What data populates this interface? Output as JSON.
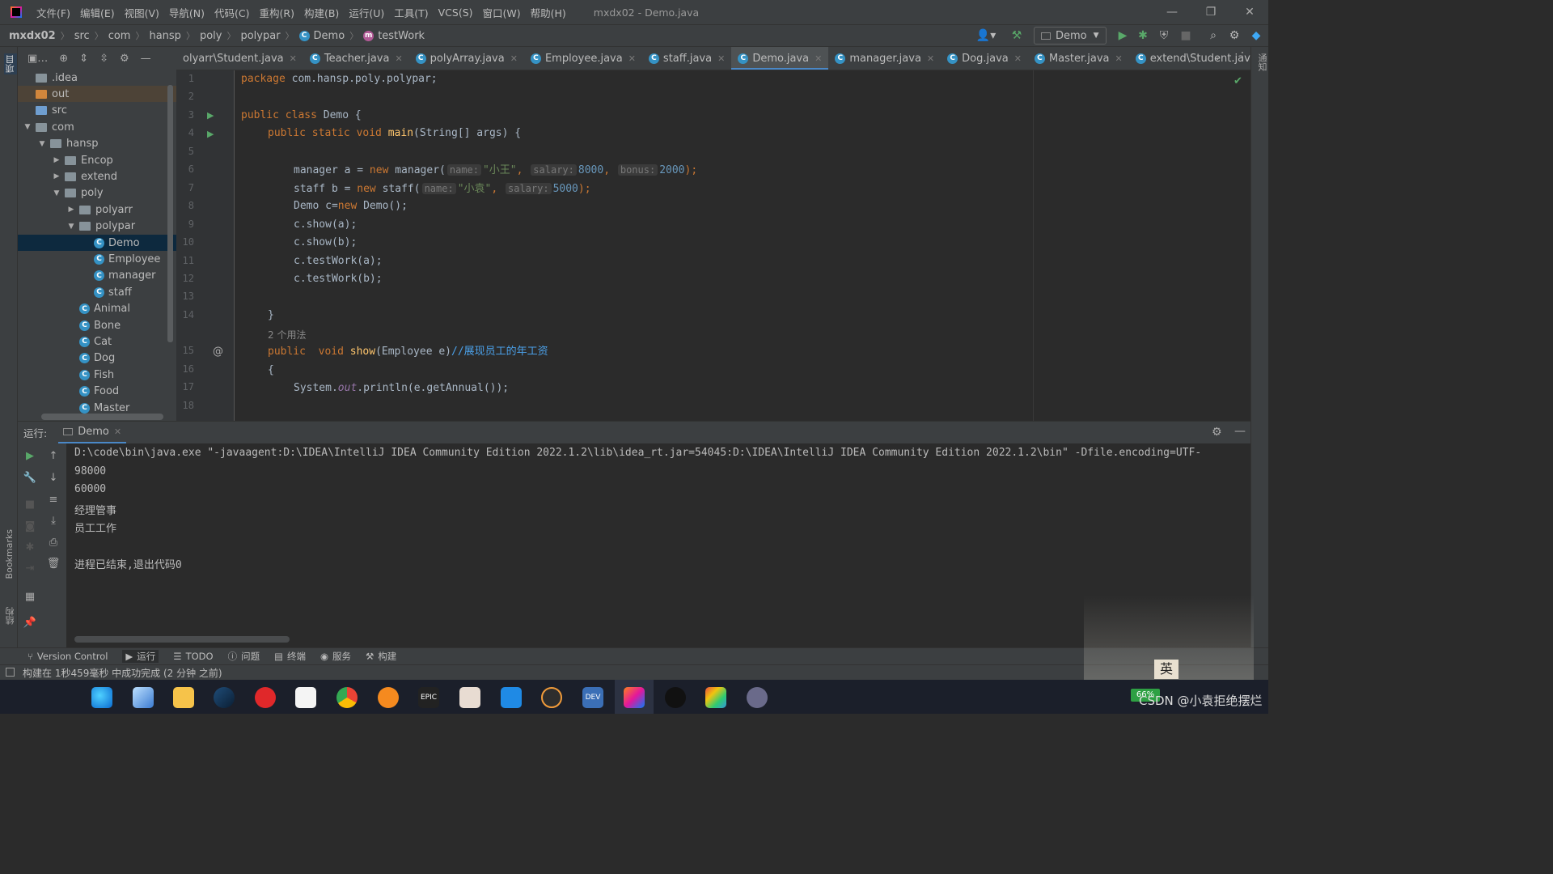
{
  "menubar": {
    "items": [
      "文件(F)",
      "编辑(E)",
      "视图(V)",
      "导航(N)",
      "代码(C)",
      "重构(R)",
      "构建(B)",
      "运行(U)",
      "工具(T)",
      "VCS(S)",
      "窗口(W)",
      "帮助(H)"
    ],
    "title": "mxdx02 - Demo.java"
  },
  "breadcrumb": [
    "mxdx02",
    "src",
    "com",
    "hansp",
    "poly",
    "polypar",
    "Demo",
    "testWork"
  ],
  "run_config": "Demo",
  "left_tools": {
    "project": "项目",
    "bookmarks": "Bookmarks",
    "structure": "结构"
  },
  "right_tools": {
    "notifications": "通知"
  },
  "tree": [
    {
      "label": ".idea",
      "indent": 0,
      "kind": "folder",
      "arrow": ""
    },
    {
      "label": "out",
      "indent": 0,
      "kind": "folder-orange",
      "arrow": "",
      "highlight": true
    },
    {
      "label": "src",
      "indent": 0,
      "kind": "folder-blue",
      "arrow": ""
    },
    {
      "label": "com",
      "indent": 0,
      "kind": "folder",
      "arrow": "down"
    },
    {
      "label": "hansp",
      "indent": 1,
      "kind": "folder",
      "arrow": "down"
    },
    {
      "label": "Encop",
      "indent": 2,
      "kind": "folder",
      "arrow": "right"
    },
    {
      "label": "extend",
      "indent": 2,
      "kind": "folder",
      "arrow": "right"
    },
    {
      "label": "poly",
      "indent": 2,
      "kind": "folder",
      "arrow": "down"
    },
    {
      "label": "polyarr",
      "indent": 3,
      "kind": "folder",
      "arrow": "right"
    },
    {
      "label": "polypar",
      "indent": 3,
      "kind": "folder",
      "arrow": "down"
    },
    {
      "label": "Demo",
      "indent": 4,
      "kind": "class",
      "arrow": "",
      "selected": true
    },
    {
      "label": "Employee",
      "indent": 4,
      "kind": "class",
      "arrow": ""
    },
    {
      "label": "manager",
      "indent": 4,
      "kind": "class",
      "arrow": ""
    },
    {
      "label": "staff",
      "indent": 4,
      "kind": "class",
      "arrow": ""
    },
    {
      "label": "Animal",
      "indent": 3,
      "kind": "class",
      "arrow": ""
    },
    {
      "label": "Bone",
      "indent": 3,
      "kind": "class",
      "arrow": ""
    },
    {
      "label": "Cat",
      "indent": 3,
      "kind": "class",
      "arrow": ""
    },
    {
      "label": "Dog",
      "indent": 3,
      "kind": "class",
      "arrow": ""
    },
    {
      "label": "Fish",
      "indent": 3,
      "kind": "class",
      "arrow": ""
    },
    {
      "label": "Food",
      "indent": 3,
      "kind": "class",
      "arrow": ""
    },
    {
      "label": "Master",
      "indent": 3,
      "kind": "class",
      "arrow": ""
    }
  ],
  "tabs": [
    {
      "label": "olyarr\\Student.java",
      "active": false
    },
    {
      "label": "Teacher.java",
      "active": false
    },
    {
      "label": "polyArray.java",
      "active": false
    },
    {
      "label": "Employee.java",
      "active": false
    },
    {
      "label": "staff.java",
      "active": false
    },
    {
      "label": "Demo.java",
      "active": true
    },
    {
      "label": "manager.java",
      "active": false
    },
    {
      "label": "Dog.java",
      "active": false
    },
    {
      "label": "Master.java",
      "active": false
    },
    {
      "label": "extend\\Student.java",
      "active": false
    }
  ],
  "line_numbers": [
    "1",
    "2",
    "3",
    "4",
    "5",
    "6",
    "7",
    "8",
    "9",
    "10",
    "11",
    "12",
    "13",
    "14",
    "15",
    "16",
    "17",
    "18"
  ],
  "code": {
    "l1_kw": "package",
    "l1_rest": " com.hansp.poly.polypar;",
    "l3_kw": "public class",
    "l3_rest": " Demo {",
    "l4_kw": "public static void",
    "l4_fn": "main",
    "l4_rest": "(String[] args) {",
    "l6_a": "manager a = ",
    "l6_new": "new",
    "l6_b": " manager(",
    "l6_h1": "name:",
    "l6_s1": "\"小王\"",
    "l6_c1": ",",
    "l6_h2": "salary:",
    "l6_n1": "8000",
    "l6_c2": ",",
    "l6_h3": "bonus:",
    "l6_n2": "2000",
    "l6_end": ");",
    "l7_a": "staff b = ",
    "l7_new": "new",
    "l7_b": " staff(",
    "l7_h1": "name:",
    "l7_s1": "\"小袁\"",
    "l7_c1": ",",
    "l7_h2": "salary:",
    "l7_n1": "5000",
    "l7_end": ");",
    "l8_a": "Demo c=",
    "l8_new": "new",
    "l8_b": " Demo();",
    "l9": "c.show(a);",
    "l10": "c.show(b);",
    "l11": "c.testWork(a);",
    "l12": "c.testWork(b);",
    "l14": "}",
    "usages": "2 个用法",
    "l15_kw1": "public",
    "l15_kw2": "void",
    "l15_fn": "show",
    "l15_rest": "(Employee e)",
    "l15_cm": "//展现员工的年工资",
    "l16": "{",
    "l17_a": "System.",
    "l17_fld": "out",
    "l17_b": ".println(e.getAnnual());"
  },
  "run_panel": {
    "label": "运行:",
    "tab": "Demo",
    "output": [
      "D:\\code\\bin\\java.exe \"-javaagent:D:\\IDEA\\IntelliJ IDEA Community Edition 2022.1.2\\lib\\idea_rt.jar=54045:D:\\IDEA\\IntelliJ IDEA Community Edition 2022.1.2\\bin\" -Dfile.encoding=UTF-",
      "98000",
      "60000",
      "经理管事",
      "员工工作",
      "",
      "进程已结束,退出代码0"
    ]
  },
  "bottom_tools": [
    "Version Control",
    "运行",
    "TODO",
    "问题",
    "终端",
    "服务",
    "构建"
  ],
  "status": "构建在 1秒459毫秒 中成功完成 (2 分钟 之前)",
  "taskbar": {
    "watermark": "CSDN @小袁拒绝摆烂",
    "ime": "英",
    "battery": "66%"
  }
}
